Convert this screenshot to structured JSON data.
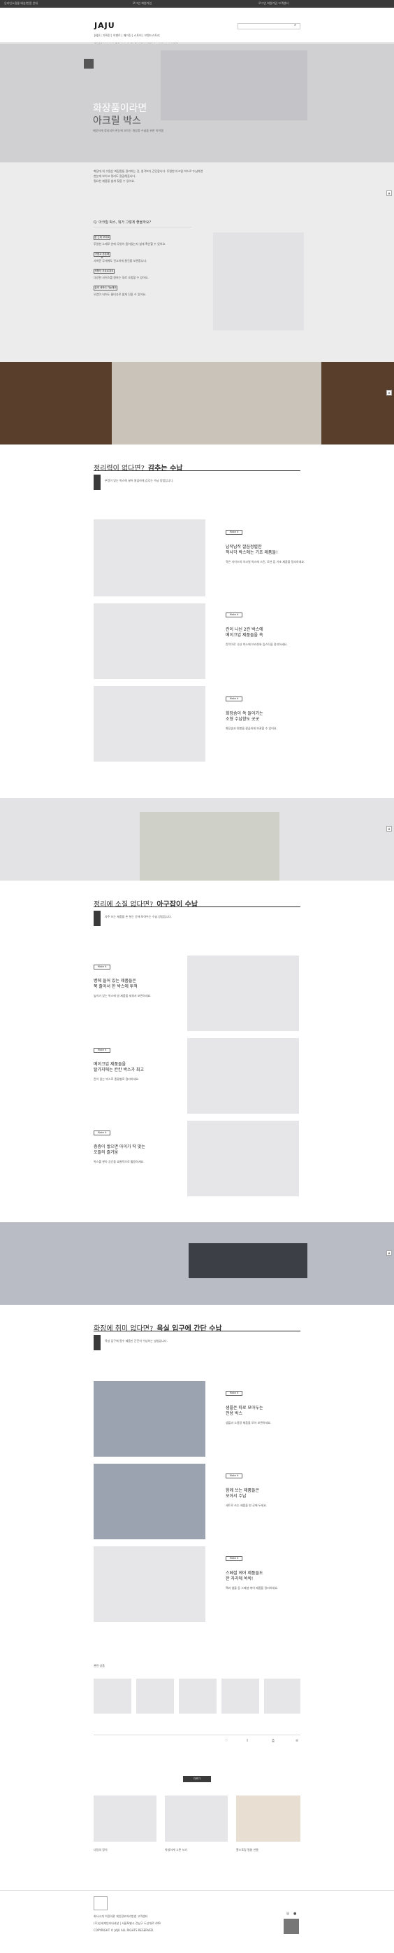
{
  "topbar": {
    "left": "온라인쇼핑몰 배송/반품 안내",
    "mid": "로그인 회원가입",
    "right": "로그인  회원가입  고객센터"
  },
  "logo": "JAJU",
  "nav_main": "SHOP  여성  남성  홈&리빙  패브릭  욕실  주방  생활  키즈  여행  뷰티  아울렛",
  "nav_small": "JAJU  | 기획전  | 이벤트  | 매거진  | 스토어  | 브랜드스토리",
  "hero": {
    "title_line1": "화장품이라면",
    "title_line2": "아크릴 박스",
    "subtitle": "깨끗하게 정리되어 한눈에 보이는 화장품 수납을 위한 아이템"
  },
  "intro": {
    "p1": "화장대 위 수많은 화장품들 정리하는 것, 생각보다 간단합니다. 투명한 아크릴 박스로 수납하면",
    "p2": "한눈에 보이고 정리도 깔끔해집니다.",
    "p3": "필요한 제품을 쉽게 찾을 수 있어요."
  },
  "faq": {
    "q": "Q. 아크릴 박스, 뭐가 그렇게 좋을까요?",
    "a1": "한 눈에 보여요",
    "a1t": "투명한 소재로 안에 무엇이 들어있는지 쉽게 확인할 수 있어요.",
    "a2": "가볍고 튼튼해요",
    "a2t": "가벼운 무게에도 견고하게 물건을 보관합니다.",
    "a3": "조합이 자유로워요",
    "a3t": "다양한 사이즈를 원하는 대로 조합할 수 있어요.",
    "a4": "쉽게 세척이 가능해요",
    "a4t": "오염이 되어도 물티슈로 쉽게 닦을 수 있어요."
  },
  "sec1": {
    "title_a": "정리력이 없다면?",
    "title_b": "감추는 수납",
    "desc": "뚜껑이 있는 박스에 넣어 깔끔하게 감추는 수납 방법입니다.",
    "items": [
      {
        "tag": "Make it",
        "title1": "납작납작 깔끔정렬한",
        "title2": "적사각 박스에는 기초 제품들!",
        "body": "작은 사이즈의 아크릴 박스에 스킨, 로션 등 기초 제품을 정리하세요."
      },
      {
        "tag": "Make it",
        "title1": "칸이 나뉜 2칸 박스에",
        "title2": "메이크업 제품들을 쏙",
        "body": "칸막이로 나뉜 박스에 브러쉬와 립스틱을 정리하세요."
      },
      {
        "tag": "Make it",
        "title1": "화장솜이 쏙 들어가는",
        "title2": "소형 수납함도 굿굿",
        "body": "화장솜과 면봉을 깔끔하게 보관할 수 있어요."
      }
    ]
  },
  "sec2": {
    "title_a": "정리에 소질 없다면?",
    "title_b": "아구잡이 수납",
    "desc": "자주 쓰는 제품을 손 닿는 곳에 모아두는 수납 방법입니다.",
    "items": [
      {
        "tag": "Make it",
        "title1": "병에 들어 있는 제품들은",
        "title2": "쭉 줄어서 한 박스에 투척",
        "body": "높이가 있는 박스에 병 제품을 세워서 보관하세요."
      },
      {
        "tag": "Make it",
        "title1": "메이크업 제품들을",
        "title2": "탈가지에는 칸칸 박스가 최고",
        "body": "칸이 있는 박스로 종류별로 정리하세요."
      },
      {
        "tag": "Make it",
        "title1": "층층이 쌓으면 아이가 딱 맞는",
        "title2": "오뜰의 즐거움",
        "body": "박스를 쌓아 공간을 효율적으로 활용하세요."
      }
    ]
  },
  "sec3": {
    "title_a": "화장에 취미 없다면?",
    "title_b": "욕실 입구에 간단 수납",
    "desc": "욕실 입구에 필수 제품만 간단히 수납하는 방법입니다.",
    "items": [
      {
        "tag": "Make it",
        "title1": "샘플은 따로 모아두는",
        "title2": "전용 박스",
        "body": "샘플과 소용량 제품을 모아 보관하세요."
      },
      {
        "tag": "Make it",
        "title1": "함께 쓰는 제품들은",
        "title2": "모아서 수납",
        "body": "세트로 쓰는 제품을 한 곳에 두세요."
      },
      {
        "tag": "Make it",
        "title1": "스페셜 케어 제품들도",
        "title2": "한 자리에 쏙쏙!",
        "body": "팩과 앰플 등 스페셜 케어 제품을 정리하세요."
      }
    ]
  },
  "related": {
    "title": "관련 상품",
    "more_label": "더보기"
  },
  "bottom_cards": [
    {
      "title": "다림의 정석"
    },
    {
      "title": "약냉하게 그릇 쓰기"
    },
    {
      "title": "홈스토링 밀봉 만들"
    }
  ],
  "footer": {
    "links": "회사소개  이용약관  개인정보처리방침  고객센터",
    "info": "(주)신세계인터내셔날 | 서울특별시 강남구 도산대로 449",
    "copy": "COPYRIGHT © JAJU ALL RIGHTS RESERVED."
  },
  "colors": {
    "dark": "#3a3a3a",
    "gray": "#d8d8da",
    "accent": "#222222"
  }
}
